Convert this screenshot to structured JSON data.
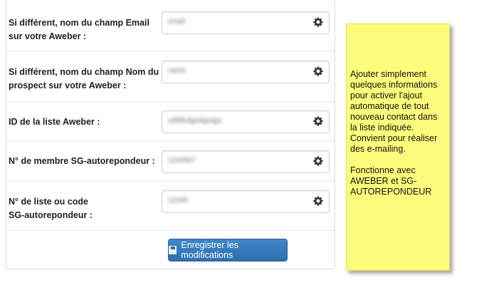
{
  "form": {
    "fields": [
      {
        "label": "Si différent, nom du champ Email\nsur votre Aweber :",
        "value": "email"
      },
      {
        "label": "Si différent, nom du champ Nom du\nprospect sur votre Aweber :",
        "value": "name"
      },
      {
        "label": "ID de la liste Aweber :",
        "value": "sdfdfsdgsdgsdgs"
      },
      {
        "label": "N° de membre SG-autorepondeur :",
        "value": "1234567"
      },
      {
        "label": "N° de liste ou code\nSG-autorepondeur :",
        "value": "12345"
      }
    ],
    "submit_label": "Enregistrer les modifications"
  },
  "note": {
    "paragraph1": "Ajouter simplement quelques informations pour activer l'ajout automatique de tout nouveau contact dans la liste indiquée. Convient pour réaliser des e-mailing.",
    "paragraph2": "Fonctionne avec AWEBER et SG-AUTOREPONDEUR"
  },
  "colors": {
    "button": "#337ab7",
    "note_background": "#fdfd7c"
  }
}
